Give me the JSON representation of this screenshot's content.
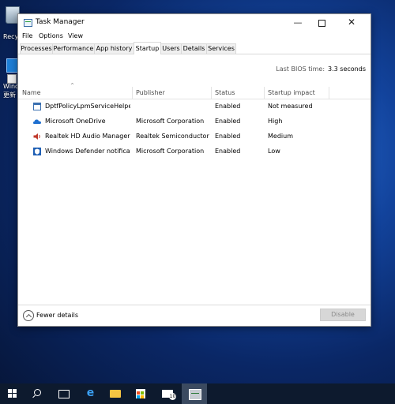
{
  "desktop": {
    "recycle_label": "Recy",
    "update_label_line1": "Wind",
    "update_label_line2": "更新"
  },
  "window": {
    "title": "Task Manager",
    "minimize_glyph": "—",
    "close_glyph": "✕"
  },
  "menu": [
    "File",
    "Options",
    "View"
  ],
  "tabs": [
    "Processes",
    "Performance",
    "App history",
    "Startup",
    "Users",
    "Details",
    "Services"
  ],
  "active_tab": "Startup",
  "bios": {
    "label": "Last BIOS time:",
    "value": "3.3 seconds"
  },
  "table": {
    "sort_glyph": "^",
    "columns": [
      "Name",
      "Publisher",
      "Status",
      "Startup impact"
    ],
    "rows": [
      {
        "icon": "app-window-icon",
        "name": "DptfPolicyLpmServiceHelper",
        "publisher": "",
        "status": "Enabled",
        "impact": "Not measured"
      },
      {
        "icon": "onedrive-icon",
        "name": "Microsoft OneDrive",
        "publisher": "Microsoft Corporation",
        "status": "Enabled",
        "impact": "High"
      },
      {
        "icon": "speaker-icon",
        "name": "Realtek HD Audio Manager",
        "publisher": "Realtek Semiconductor",
        "status": "Enabled",
        "impact": "Medium"
      },
      {
        "icon": "defender-shield-icon",
        "name": "Windows Defender notificati...",
        "publisher": "Microsoft Corporation",
        "status": "Enabled",
        "impact": "Low"
      }
    ]
  },
  "footer": {
    "fewer_details": "Fewer details",
    "disable": "Disable"
  },
  "taskbar": {
    "mail_badge": "10"
  }
}
